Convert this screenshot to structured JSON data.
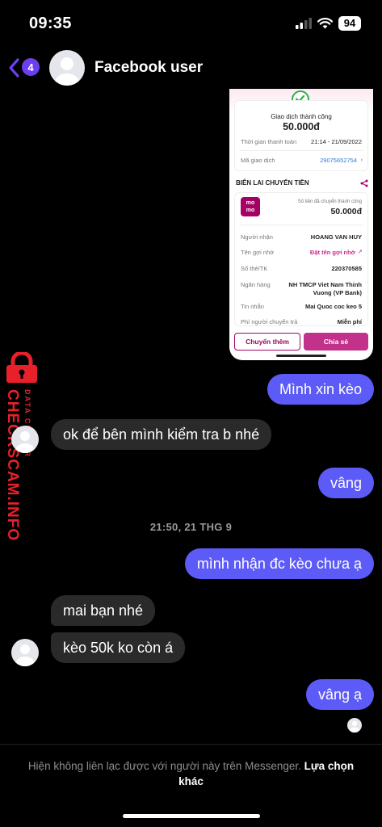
{
  "status": {
    "time": "09:35",
    "battery": "94"
  },
  "header": {
    "unread_badge": "4",
    "contact_name": "Facebook user"
  },
  "receipt": {
    "status_title": "Giao dịch thành công",
    "amount": "50.000đ",
    "pay_time_label": "Thời gian thanh toán",
    "pay_time_value": "21:14 - 21/09/2022",
    "tx_code_label": "Mã giao dịch",
    "tx_code_value": "29075652754",
    "section_title": "BIÊN LAI CHUYỂN TIỀN",
    "logo_text": "mo mo",
    "transferred_label": "Số tiền đã chuyển thành công",
    "transferred_amount": "50.000đ",
    "rows": [
      {
        "label": "Người nhận",
        "value": "HOANG VAN HUY"
      },
      {
        "label": "Tên gợi nhớ",
        "value": "Đặt tên gợi nhớ"
      },
      {
        "label": "Số thẻ/TK",
        "value": "220370585"
      },
      {
        "label": "Ngân hàng",
        "value": "NH TMCP Viet Nam Thinh Vuong (VP Bank)"
      },
      {
        "label": "Tin nhắn",
        "value": "Mai Quoc coc keo 5"
      },
      {
        "label": "Phí người chuyển trả",
        "value": "Miễn phí"
      }
    ],
    "btn_transfer_more": "Chuyển thêm",
    "btn_share": "Chia sẻ"
  },
  "messages": [
    {
      "sender": "me",
      "text": "Mình xin kèo"
    },
    {
      "sender": "them",
      "text": "ok để bên mình kiểm tra b nhé"
    },
    {
      "sender": "me",
      "text": "vâng"
    },
    {
      "sender": "me",
      "text": "mình nhận đc kèo chưa ạ"
    },
    {
      "sender": "them",
      "text": "mai bạn nhé"
    },
    {
      "sender": "them",
      "text": "kèo 50k ko còn á"
    },
    {
      "sender": "me",
      "text": "vâng ạ"
    }
  ],
  "timestamp": "21:50, 21 THG 9",
  "watermark": {
    "line1": "DATA CENTER",
    "line2": "CHECKSCAM.INFO"
  },
  "footer": {
    "notice": "Hiện không liên lạc được với người này trên Messenger.",
    "link": "Lựa chọn khác"
  },
  "colors": {
    "my_bubble": "#5d5bf7",
    "their_bubble": "#2a2a2a",
    "accent": "#6b3ff0",
    "momo": "#a50064",
    "watermark": "#e8202a"
  }
}
